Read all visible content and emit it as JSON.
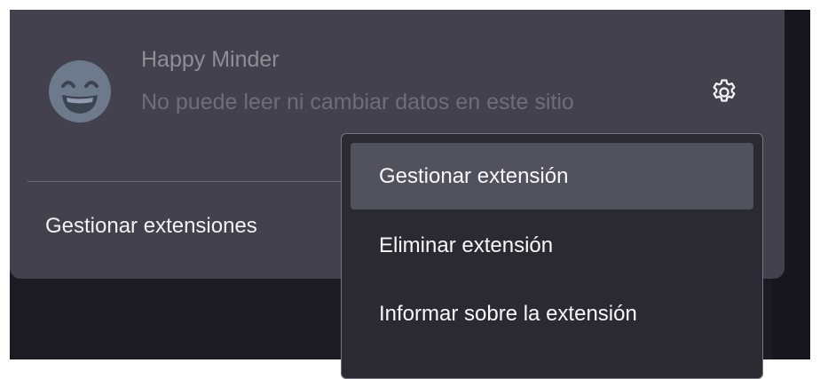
{
  "extension": {
    "name": "Happy Minder",
    "permission": "No puede leer ni cambiar datos en este sitio",
    "icon": "grinning-face-icon"
  },
  "actions": {
    "settings_icon": "gear-icon",
    "manage_extensions_label": "Gestionar extensiones"
  },
  "context_menu": {
    "items": [
      {
        "label": "Gestionar extensión",
        "highlighted": true
      },
      {
        "label": "Eliminar extensión",
        "highlighted": false
      },
      {
        "label": "Informar sobre la extensión",
        "highlighted": false
      }
    ]
  },
  "colors": {
    "panel": "#42414d",
    "menu": "#2b2a33",
    "menu_highlight": "#52515e",
    "background": "#1c1b22"
  }
}
